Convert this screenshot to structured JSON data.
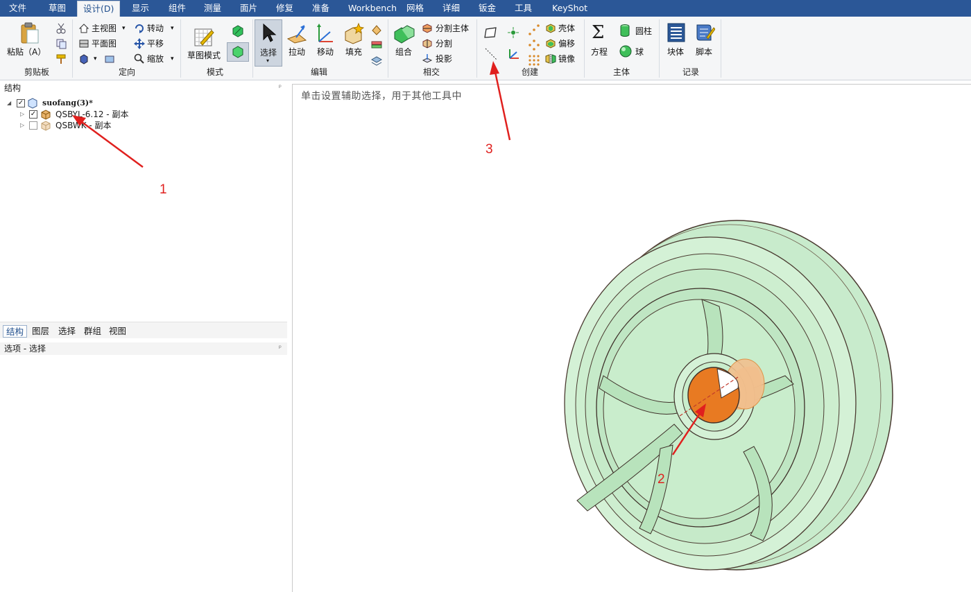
{
  "menu": {
    "tabs": [
      "文件",
      "草图",
      "设计(D)",
      "显示",
      "组件",
      "测量",
      "面片",
      "修复",
      "准备",
      "Workbench",
      "网格",
      "详细",
      "钣金",
      "工具",
      "KeyShot"
    ]
  },
  "ribbon": {
    "clipboard": {
      "paste": "粘贴（A）",
      "group": "剪贴板"
    },
    "orient": {
      "home": "主视图",
      "plan": "平面图",
      "spin": "转动",
      "pan": "平移",
      "zoom": "缩放",
      "group": "定向"
    },
    "mode": {
      "sketch": "草图模式",
      "group": "模式"
    },
    "edit": {
      "select": "选择",
      "pull": "拉动",
      "move": "移动",
      "fill": "填充",
      "group": "编辑"
    },
    "intersect": {
      "combine": "组合",
      "split_body": "分割主体",
      "split": "分割",
      "project": "投影",
      "group": "相交"
    },
    "create": {
      "shell": "壳体",
      "offset": "偏移",
      "mirror": "镜像",
      "group": "创建"
    },
    "body": {
      "equation": "方程",
      "cylinder": "圆柱",
      "sphere": "球",
      "group": "主体"
    },
    "record": {
      "block": "块体",
      "script": "脚本",
      "group": "记录"
    }
  },
  "structure": {
    "title": "结构",
    "root": "suofang(3)*",
    "items": [
      {
        "label": "QSBYL-6.12 - 副本",
        "checked": true
      },
      {
        "label": "QSBWK - 副本",
        "checked": false
      }
    ]
  },
  "bottom_tabs": [
    "结构",
    "图层",
    "选择",
    "群组",
    "视图"
  ],
  "options": {
    "title": "选项 - 选择"
  },
  "viewport": {
    "hint": "单击设置辅助选择，用于其他工具中"
  },
  "annotations": [
    "1",
    "2",
    "3"
  ],
  "colors": {
    "menubar": "#2b5797",
    "model": "#cdeecf",
    "highlight": "#e87a22",
    "annotation": "#e0201e"
  }
}
